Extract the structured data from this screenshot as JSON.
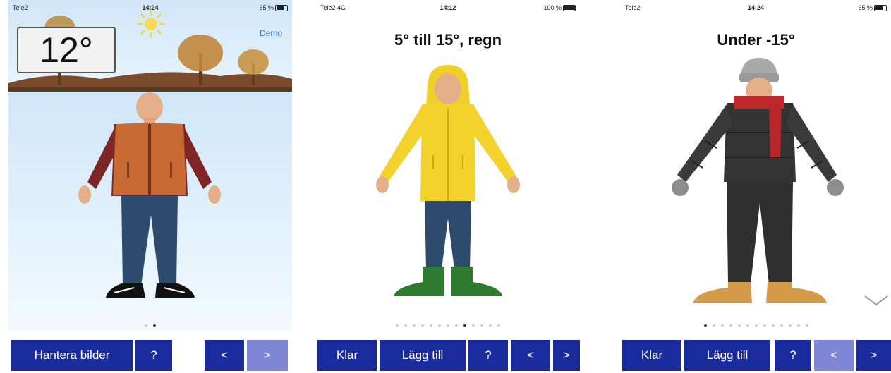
{
  "screens": [
    {
      "status": {
        "carrier": "Tele2",
        "time": "14:24",
        "battery": "65 %"
      },
      "temperature": "12°",
      "demo_link": "Demo",
      "pages": {
        "count": 2,
        "active": 1
      },
      "buttons": [
        "Hantera bilder",
        "?",
        "<",
        ">"
      ]
    },
    {
      "status": {
        "carrier": "Tele2 4G",
        "time": "14:12",
        "battery": "100 %"
      },
      "title": "5° till 15°, regn",
      "pages": {
        "count": 13,
        "active": 8
      },
      "buttons": [
        "Klar",
        "Lägg till",
        "?",
        "<",
        ">"
      ]
    },
    {
      "status": {
        "carrier": "Tele2",
        "time": "14:24",
        "battery": "65 %"
      },
      "title": "Under -15°",
      "pages": {
        "count": 13,
        "active": 0
      },
      "buttons": [
        "Klar",
        "Lägg till",
        "?",
        "<",
        ">"
      ]
    }
  ],
  "icons": [
    "wifi-icon",
    "battery-icon",
    "sun-icon",
    "chevron-down-icon"
  ],
  "colors": {
    "button": "#1a2b9e",
    "button_disabled": "#7f86d6",
    "link": "#3a74d8"
  }
}
